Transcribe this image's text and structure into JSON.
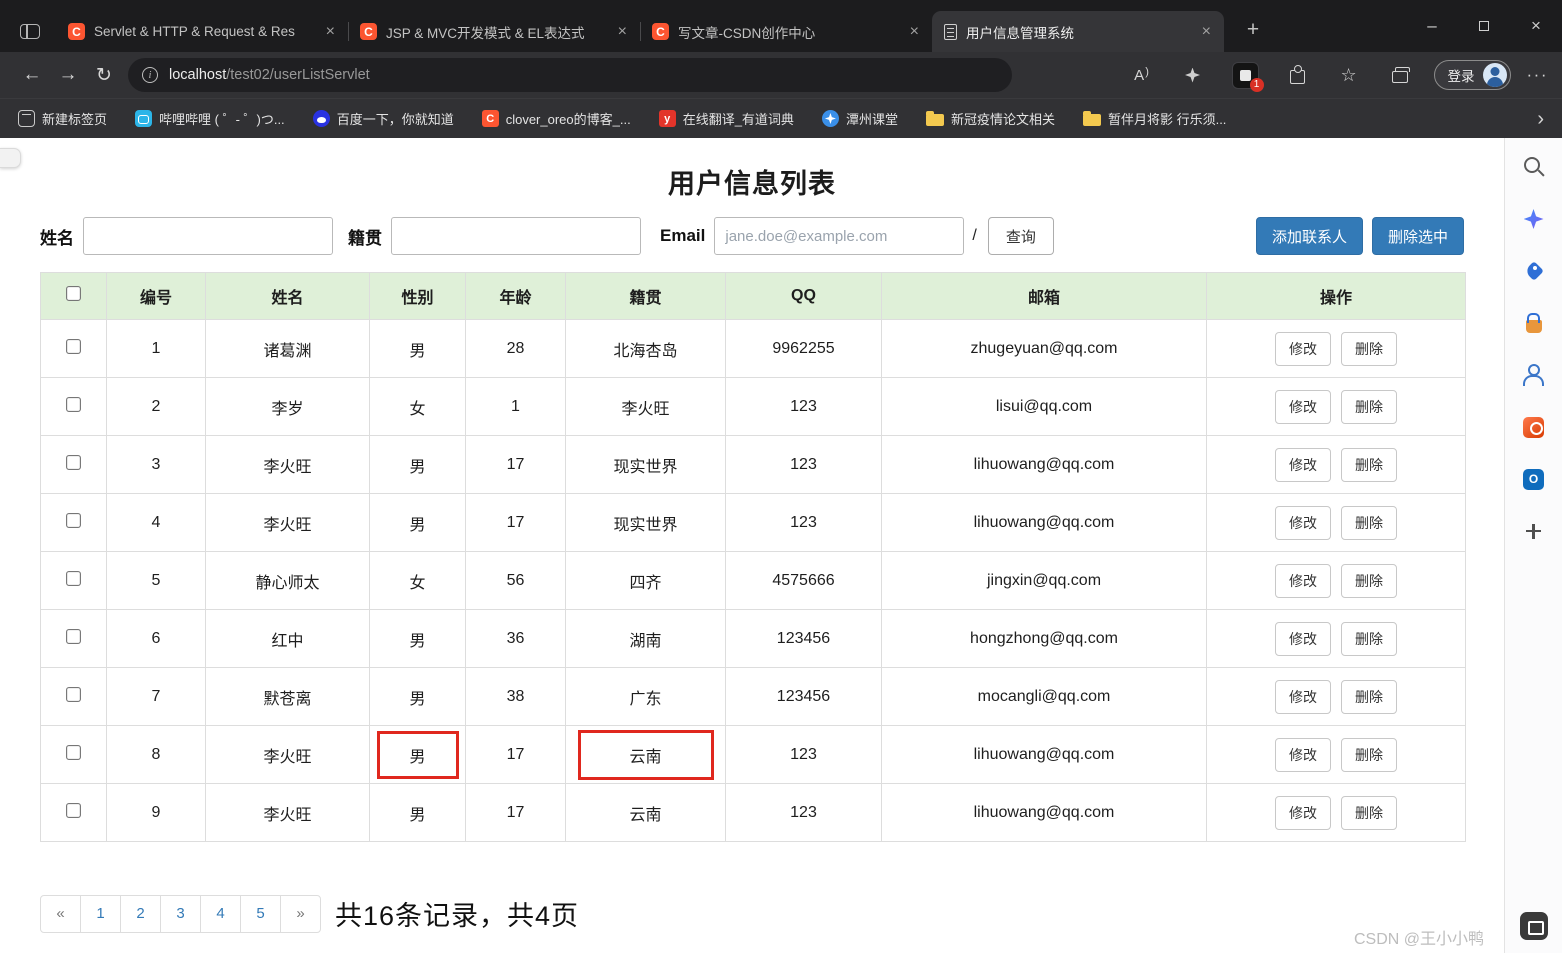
{
  "browser": {
    "tabs": [
      {
        "title": "Servlet & HTTP & Request & Res",
        "favicon": "csdn",
        "active": false
      },
      {
        "title": "JSP & MVC开发模式 & EL表达式",
        "favicon": "csdn",
        "active": false
      },
      {
        "title": "写文章-CSDN创作中心",
        "favicon": "csdn",
        "active": false
      },
      {
        "title": "用户信息管理系统",
        "favicon": "doc",
        "active": true
      }
    ],
    "url_host": "localhost",
    "url_path": "/test02/userListServlet",
    "login_label": "登录",
    "navbar": {
      "icons": [
        "read-aloud",
        "shopping-sparkle",
        "extension-notification",
        "extensions",
        "favorites",
        "collections"
      ],
      "extension_badge": "1"
    },
    "bookmarks": [
      {
        "label": "新建标签页",
        "icon": "newtab"
      },
      {
        "label": "哔哩哔哩 ( ゜- ゜)つ...",
        "icon": "bilibili"
      },
      {
        "label": "百度一下，你就知道",
        "icon": "baidu"
      },
      {
        "label": "clover_oreo的博客_...",
        "icon": "csdn"
      },
      {
        "label": "在线翻译_有道词典",
        "icon": "youdao"
      },
      {
        "label": "潭州课堂",
        "icon": "tanzhou"
      },
      {
        "label": "新冠疫情论文相关",
        "icon": "folder"
      },
      {
        "label": "暂伴月将影 行乐须...",
        "icon": "folder"
      }
    ]
  },
  "page": {
    "title": "用户信息列表",
    "filters": {
      "name_label": "姓名",
      "origin_label": "籍贯",
      "email_label": "Email",
      "email_placeholder": "jane.doe@example.com",
      "separator": "/",
      "search_button": "查询"
    },
    "actions": {
      "add_button": "添加联系人",
      "delete_button": "删除选中"
    },
    "table": {
      "headers": [
        "编号",
        "姓名",
        "性别",
        "年龄",
        "籍贯",
        "QQ",
        "邮箱",
        "操作"
      ],
      "edit_label": "修改",
      "delete_label": "删除",
      "rows": [
        {
          "id": "1",
          "name": "诸葛渊",
          "gender": "男",
          "age": "28",
          "origin": "北海杏岛",
          "qq": "9962255",
          "email": "zhugeyuan@qq.com",
          "red": []
        },
        {
          "id": "2",
          "name": "李岁",
          "gender": "女",
          "age": "1",
          "origin": "李火旺",
          "qq": "123",
          "email": "lisui@qq.com",
          "red": []
        },
        {
          "id": "3",
          "name": "李火旺",
          "gender": "男",
          "age": "17",
          "origin": "现实世界",
          "qq": "123",
          "email": "lihuowang@qq.com",
          "red": []
        },
        {
          "id": "4",
          "name": "李火旺",
          "gender": "男",
          "age": "17",
          "origin": "现实世界",
          "qq": "123",
          "email": "lihuowang@qq.com",
          "red": []
        },
        {
          "id": "5",
          "name": "静心师太",
          "gender": "女",
          "age": "56",
          "origin": "四齐",
          "qq": "4575666",
          "email": "jingxin@qq.com",
          "red": []
        },
        {
          "id": "6",
          "name": "红中",
          "gender": "男",
          "age": "36",
          "origin": "湖南",
          "qq": "123456",
          "email": "hongzhong@qq.com",
          "red": []
        },
        {
          "id": "7",
          "name": "默苍离",
          "gender": "男",
          "age": "38",
          "origin": "广东",
          "qq": "123456",
          "email": "mocangli@qq.com",
          "red": []
        },
        {
          "id": "8",
          "name": "李火旺",
          "gender": "男",
          "age": "17",
          "origin": "云南",
          "qq": "123",
          "email": "lihuowang@qq.com",
          "red": [
            "gender",
            "origin"
          ]
        },
        {
          "id": "9",
          "name": "李火旺",
          "gender": "男",
          "age": "17",
          "origin": "云南",
          "qq": "123",
          "email": "lihuowang@qq.com",
          "red": []
        }
      ]
    },
    "pagination": {
      "items": [
        "«",
        "1",
        "2",
        "3",
        "4",
        "5",
        "»"
      ],
      "summary": "共16条记录，共4页"
    },
    "watermark": "CSDN @王小小鸭"
  },
  "sidebar": {
    "icons": [
      "search",
      "copilot",
      "tag",
      "shopping",
      "profile",
      "office",
      "outlook",
      "add"
    ],
    "bottom_icon": "drop"
  },
  "colors": {
    "accent_blue": "#337ab7",
    "table_header_bg": "#dff0d8",
    "highlight_red": "#e0281e",
    "csdn_brand": "#fc5531",
    "chrome_dark": "#1c1c1e"
  }
}
